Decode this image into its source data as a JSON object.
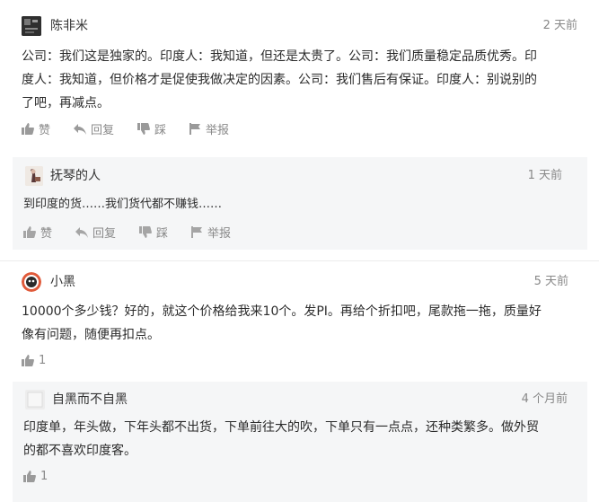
{
  "comments": [
    {
      "username": "陈非米",
      "time": "2 天前",
      "body_lines": [
        "公司：我们这是独家的。印度人：我知道，但还是太贵了。公司：我们质量稳定品质优秀。印",
        "度人：我知道，但价格才是促使我做决定的因素。公司：我们售后有保证。印度人：别说别的",
        "了吧，再减点。"
      ],
      "actions": {
        "like": "赞",
        "reply": "回复",
        "dislike": "踩",
        "report": "举报"
      }
    },
    {
      "username": "抚琴的人",
      "time": "1 天前",
      "body_lines": [
        "到印度的货……我们货代都不赚钱……"
      ],
      "actions": {
        "like": "赞",
        "reply": "回复",
        "dislike": "踩",
        "report": "举报"
      }
    },
    {
      "username": "小黑",
      "time": "5 天前",
      "body_lines": [
        "10000个多少钱？好的，就这个价格给我来10个。发PI。再给个折扣吧，尾款拖一拖，质量好",
        "像有问题，随便再扣点。"
      ],
      "like_count": "1"
    },
    {
      "username": "自黑而不自黑",
      "time": "4 个月前",
      "body_lines": [
        "印度单，年头做，下年头都不出货，下单前往大的吹，下单只有一点点，还种类繁多。做外贸",
        "的都不喜欢印度客。"
      ],
      "like_count": "1"
    }
  ]
}
